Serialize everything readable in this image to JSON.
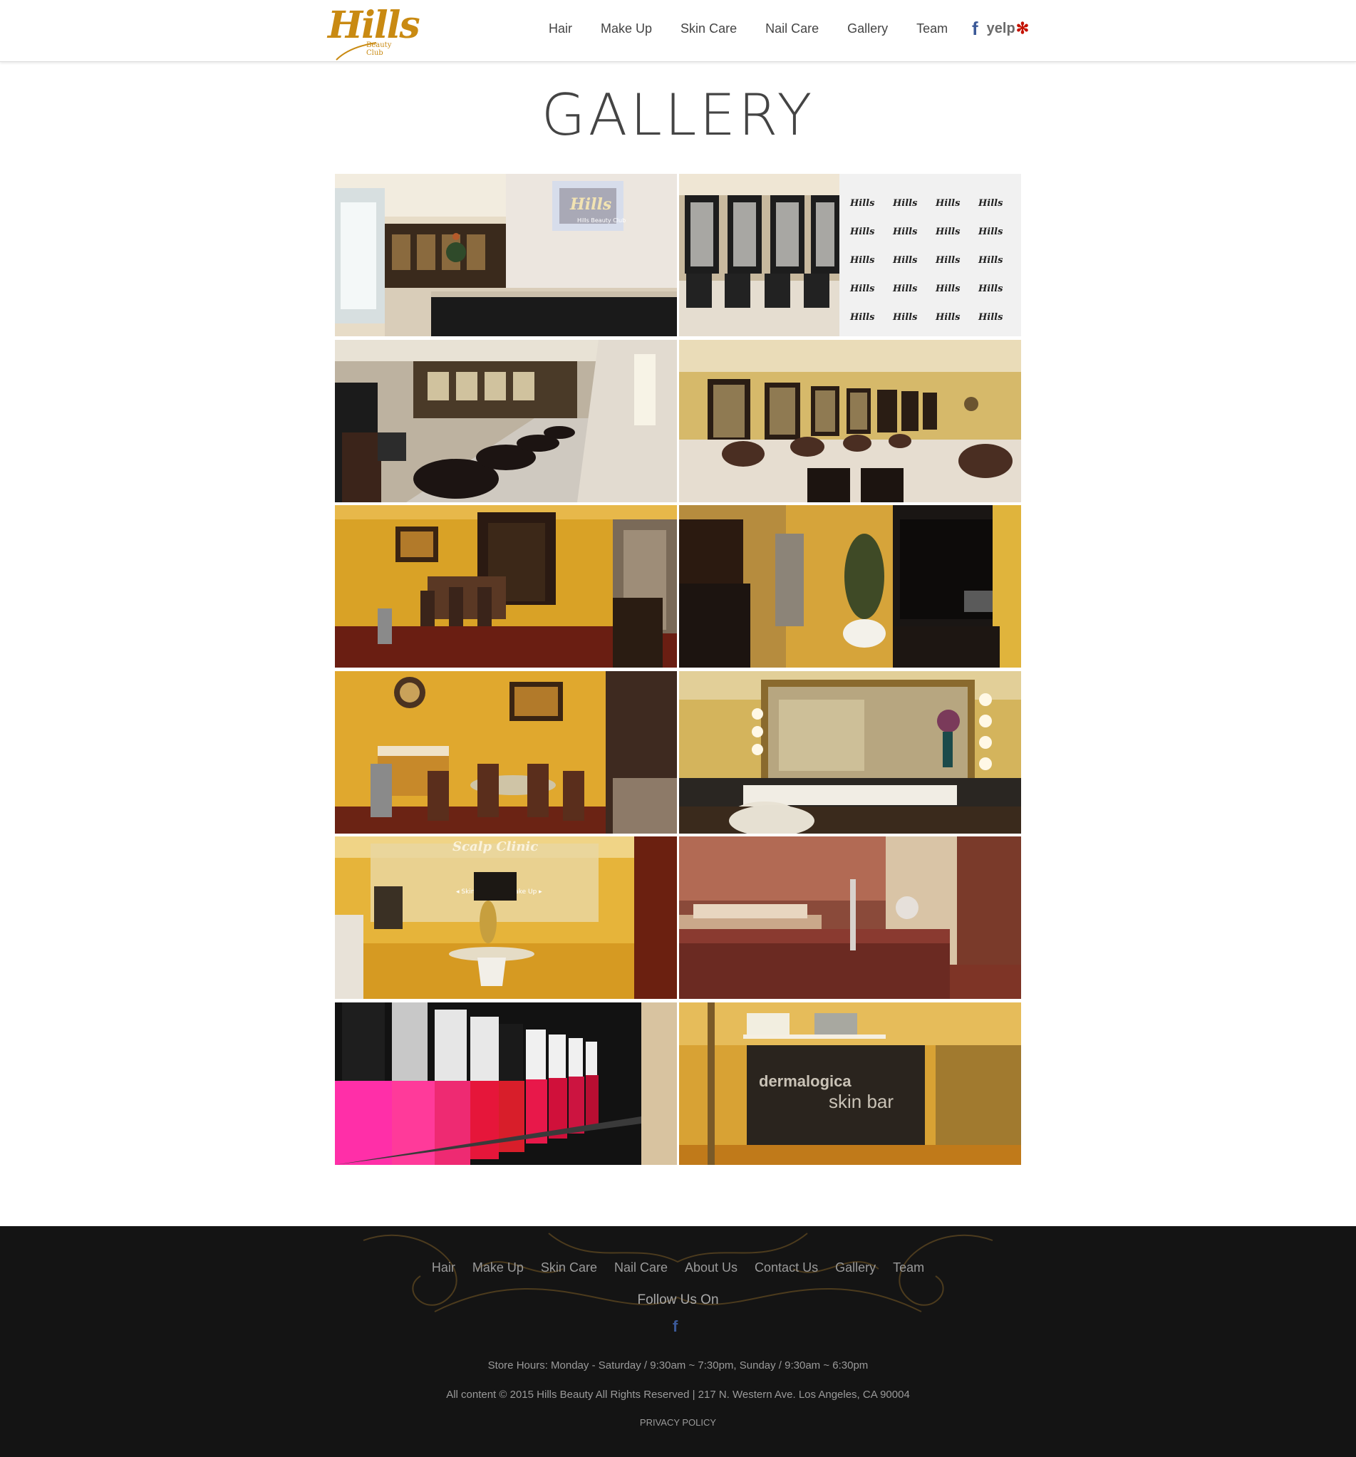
{
  "header": {
    "logo": {
      "word": "Hills",
      "sub": "Beauty Club"
    },
    "nav": [
      "Hair",
      "Make Up",
      "Skin Care",
      "Nail Care",
      "Gallery",
      "Team"
    ],
    "social": {
      "facebook": "f",
      "yelp": "yelp"
    }
  },
  "main": {
    "title": "GALLERY",
    "photos": [
      {
        "name": "reception-desk-photo",
        "wall_text": "Hills",
        "wall_sub": "Hills Beauty Club"
      },
      {
        "name": "salon-stations-photo",
        "wall_text": "Hills"
      },
      {
        "name": "hair-wash-area-photo"
      },
      {
        "name": "salon-chairs-mirrors-photo"
      },
      {
        "name": "lounge-dining-photo"
      },
      {
        "name": "hallway-elevator-photo"
      },
      {
        "name": "waiting-room-photo"
      },
      {
        "name": "makeup-vanity-photo"
      },
      {
        "name": "scalp-clinic-photo",
        "sign_text": "Scalp Clinic",
        "sign_sub": "◂ Skin  Hair Care   Make Up ▸"
      },
      {
        "name": "treatment-room-photo"
      },
      {
        "name": "nail-polish-photo"
      },
      {
        "name": "dermalogica-skin-bar-photo",
        "sign_text": "dermalogica",
        "sign_sub": "skin bar"
      }
    ]
  },
  "footer": {
    "nav": [
      "Hair",
      "Make Up",
      "Skin Care",
      "Nail Care",
      "About Us",
      "Contact Us",
      "Gallery",
      "Team"
    ],
    "follow": "Follow Us On",
    "facebook": "f",
    "hours": "Store Hours: Monday - Saturday / 9:30am ~ 7:30pm, Sunday / 9:30am ~ 6:30pm",
    "copyright": "All content © 2015 Hills Beauty All Rights Reserved | 217 N. Western Ave. Los Angeles, CA 90004",
    "privacy": "PRIVACY POLICY"
  },
  "colors": {
    "brand_gold": "#c98a12",
    "footer_bg": "#141414",
    "facebook_blue": "#3b5998",
    "yelp_red": "#c41200"
  }
}
